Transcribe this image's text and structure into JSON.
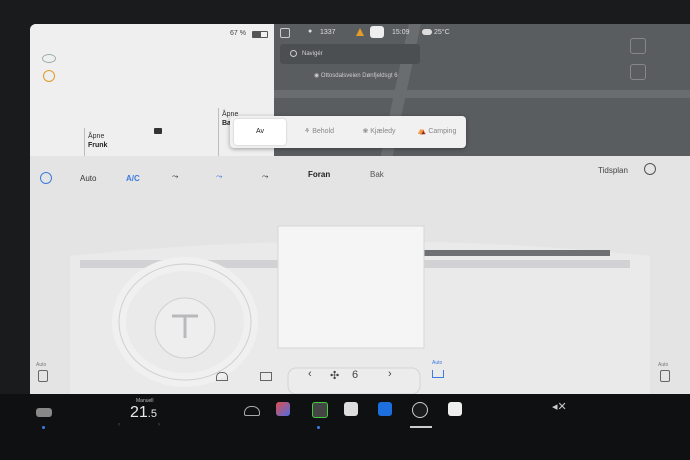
{
  "status": {
    "battery": "67 %",
    "odometer": "1337",
    "time": "15:09",
    "weather_temp": "25°C"
  },
  "map": {
    "search_placeholder": "Navigér",
    "place_label": "Ottosdalsveien Dønfjeldsgt 6"
  },
  "doors": {
    "front": {
      "line1": "Åpne",
      "line2": "Frunk"
    },
    "rear": {
      "line1": "Åpne",
      "line2": "Ba"
    }
  },
  "modes": [
    {
      "label": "Av",
      "active": true
    },
    {
      "label": "Behold",
      "active": false
    },
    {
      "label": "Kjæledy",
      "active": false
    },
    {
      "label": "Camping",
      "active": false
    }
  ],
  "climate": {
    "auto": "Auto",
    "ac": "A/C",
    "front": "Foran",
    "rear": "Bak",
    "schedule": "Tidsplan",
    "fan_speed": "6",
    "auto_small": "Auto",
    "auto_small_right": "Auto",
    "seat_auto": "Auto"
  },
  "dock": {
    "temp_label": "Manuell",
    "temp_value": "21",
    "temp_decimal": ".5"
  },
  "colors": {
    "accent": "#3d7be0",
    "map_bg": "#5a5d60"
  }
}
